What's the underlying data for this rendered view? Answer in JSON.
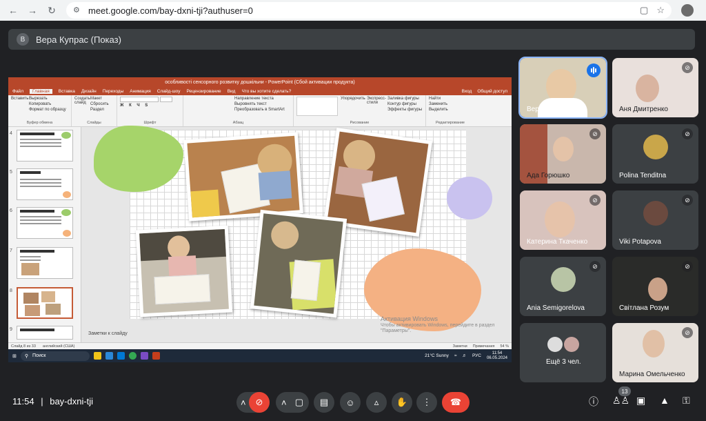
{
  "browser": {
    "url": "meet.google.com/bay-dxni-tji?authuser=0",
    "back_icon": "arrow-left-icon",
    "forward_icon": "arrow-right-icon",
    "reload_icon": "reload-icon"
  },
  "presenter": {
    "initial": "В",
    "label": "Вера Купрас (Показ)"
  },
  "ppt": {
    "title": "особливості сенсорного розвитку дошкільни - PowerPoint (Сбой активации продукта)",
    "tabs": [
      "Файл",
      "Главная",
      "Вставка",
      "Дизайн",
      "Переходы",
      "Анимация",
      "Слайд-шоу",
      "Рецензирование",
      "Вид",
      "Что вы хотите сделать?"
    ],
    "tabs_right": [
      "Вход",
      "Общий доступ"
    ],
    "ribbon": {
      "paste": "Вставить",
      "cut": "Вырезать",
      "copy": "Копировать",
      "format_painter": "Формат по образцу",
      "clipboard": "Буфер обмена",
      "layout": "Макет",
      "reset": "Сбросить",
      "section": "Раздел",
      "new_slide": "Создать слайд",
      "slides": "Слайды",
      "font": "Шрифт",
      "text_direction": "Направление текста",
      "align_text": "Выровнять текст",
      "smartart": "Преобразовать в SmartArt",
      "paragraph": "Абзац",
      "arrange": "Упорядочить",
      "quick_styles": "Экспресс-стили",
      "shape_fill": "Заливка фигуры",
      "shape_outline": "Контур фигуры",
      "shape_effects": "Эффекты фигуры",
      "drawing": "Рисование",
      "find": "Найти",
      "replace": "Заменить",
      "select": "Выделить",
      "editing": "Редактирование"
    },
    "thumb_numbers": [
      "4",
      "5",
      "6",
      "7",
      "8",
      "9"
    ],
    "notes": "Заметки к слайду",
    "status_left": [
      "Слайд 8 из 33",
      "английский (США)"
    ],
    "status_right": [
      "Заметки",
      "Примечания",
      "54 %"
    ],
    "watermark_title": "Активация Windows",
    "watermark_sub": "Чтобы активировать Windows, перейдите в раздел \"Параметры\".",
    "taskbar": {
      "search": "Поиск",
      "weather": "21°C  Sunny",
      "lang": "РУС",
      "time": "11:54",
      "date": "06.05.2024"
    }
  },
  "participants": [
    {
      "name": "Вера Купрас",
      "speaking": true
    },
    {
      "name": "Аня Дмитренко",
      "muted": true
    },
    {
      "name": "Ада Горюшко",
      "muted": true
    },
    {
      "name": "Polina Tenditna",
      "muted": true
    },
    {
      "name": "Катерина Ткаченко",
      "muted": true
    },
    {
      "name": "Viki Potapova",
      "muted": true
    },
    {
      "name": "Ania Semigorelova",
      "muted": true
    },
    {
      "name": "Світлана Розум",
      "muted": true
    },
    {
      "name": "Ещё 3 чел."
    },
    {
      "name": "Марина Омельченко",
      "muted": true
    }
  ],
  "bottom": {
    "time": "11:54",
    "separator": "|",
    "meeting_code": "bay-dxni-tji",
    "participants_count": "13"
  },
  "colors": {
    "meet_bg": "#202124",
    "tile_bg": "#3c4043",
    "end_call": "#ea4335",
    "ppt_accent": "#b7472a",
    "speaking_blue": "#1a73e8"
  }
}
